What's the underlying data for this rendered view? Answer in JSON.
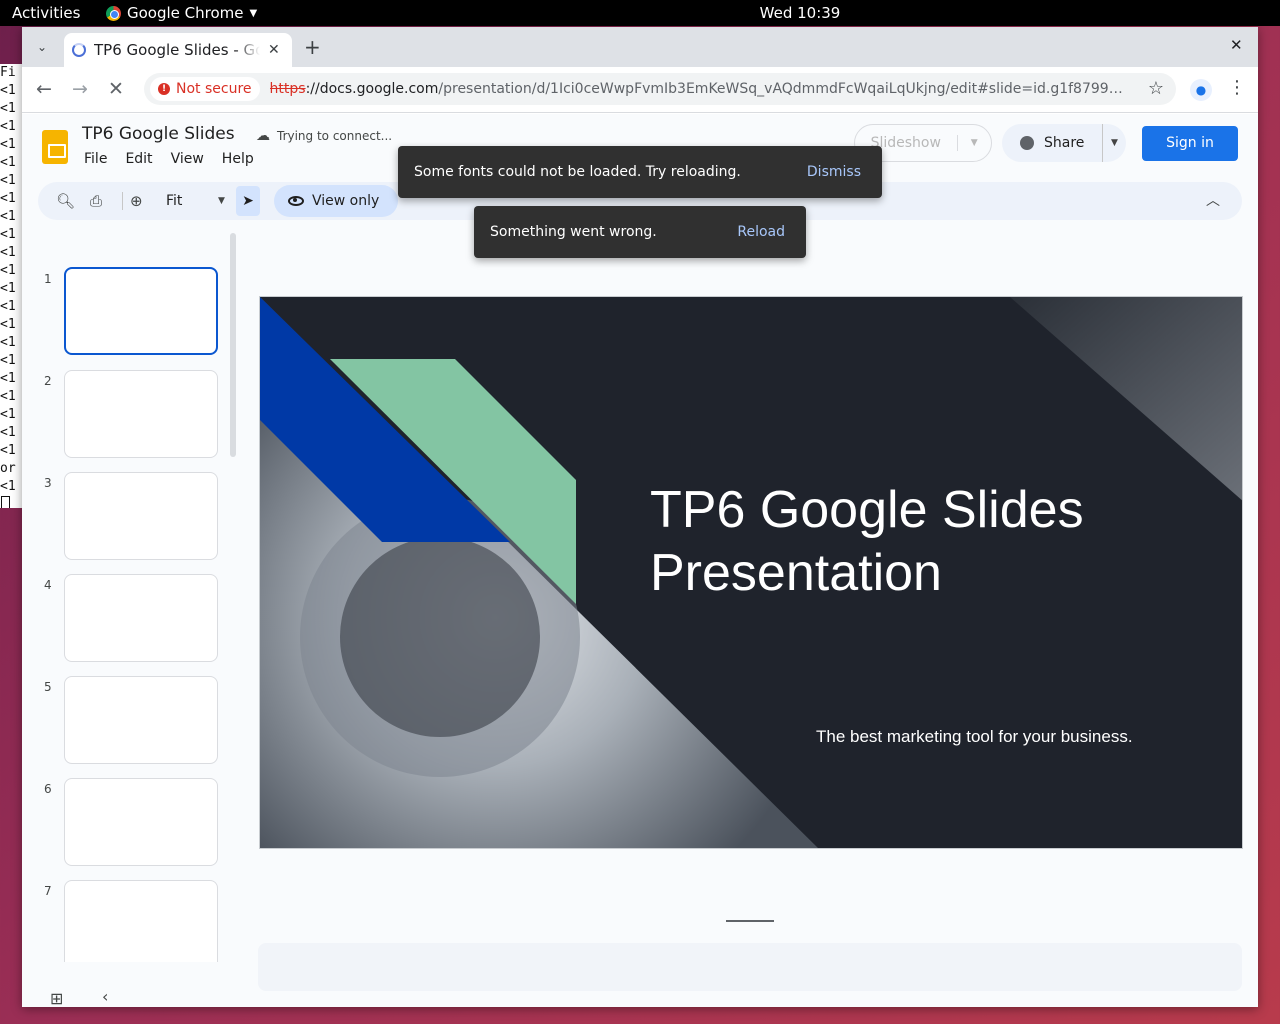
{
  "system": {
    "activities": "Activities",
    "app_name": "Google Chrome",
    "clock": "Wed 10:39"
  },
  "terminal": {
    "lines": [
      "Fi",
      "<1",
      "<1",
      "<1",
      "<1",
      "<1",
      "<1",
      "<1",
      "<1",
      "<1",
      "<1",
      "<1",
      "<1",
      "<1",
      "<1",
      "<1",
      "<1",
      "<1",
      "<1",
      "<1",
      "<1",
      "<1",
      "or",
      "<1"
    ]
  },
  "browser": {
    "tab_title": "TP6 Google Slides - Google Slides",
    "url_scheme": "https",
    "url_host": "://docs.google.com",
    "url_path": "/presentation/d/1Ici0ceWwpFvmIb3EmKeWSq_vAQdmmdFcWqaiLqUkjng/edit#slide=id.g1f87997…",
    "security_label": "Not secure"
  },
  "docs": {
    "title": "TP6 Google Slides",
    "menu": [
      "File",
      "Edit",
      "View",
      "Help"
    ],
    "connection_status": "Trying to connect...",
    "slideshow_label": "Slideshow",
    "share_label": "Share",
    "signin_label": "Sign in",
    "zoom_label": "Fit",
    "view_mode_label": "View only"
  },
  "filmstrip": {
    "slide_numbers": [
      "1",
      "2",
      "3",
      "4",
      "5",
      "6",
      "7"
    ],
    "active_slide": 1
  },
  "slide": {
    "title": "TP6 Google Slides Presentation",
    "subtitle": "The best marketing tool for your business.",
    "colors": {
      "background": "#1f232c",
      "blue_band": "#0039a6",
      "green_band": "#83c5a3"
    }
  },
  "notifications": {
    "fonts": {
      "message": "Some fonts could not be loaded. Try reloading.",
      "action": "Dismiss"
    },
    "error": {
      "message": "Something went wrong.",
      "action": "Reload"
    }
  }
}
